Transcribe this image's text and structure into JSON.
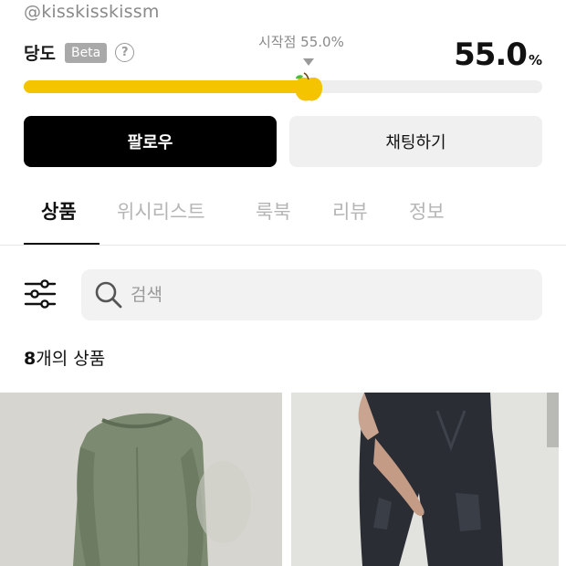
{
  "profile": {
    "handle": "@kisskisskissm"
  },
  "sweetness": {
    "label": "당도",
    "badge": "Beta",
    "help_glyph": "?",
    "start_label": "시작점 55.0%",
    "value_number": "55.0",
    "value_unit": "%",
    "progress_percent": 55.0,
    "fill_color": "#f5c400",
    "track_color": "#eeeeee"
  },
  "actions": {
    "follow_label": "팔로우",
    "chat_label": "채팅하기"
  },
  "tabs": [
    {
      "label": "상품",
      "active": true
    },
    {
      "label": "위시리스트",
      "active": false
    },
    {
      "label": "룩북",
      "active": false
    },
    {
      "label": "리뷰",
      "active": false
    },
    {
      "label": "정보",
      "active": false
    }
  ],
  "search": {
    "placeholder": "검색",
    "filter_icon": "sliders-icon",
    "search_icon": "magnifier-icon"
  },
  "products": {
    "count_number": "8",
    "count_suffix": "개의 상품",
    "items": [
      {
        "image": "green-long-sleeve-top"
      },
      {
        "image": "black-cargo-pants"
      }
    ]
  }
}
